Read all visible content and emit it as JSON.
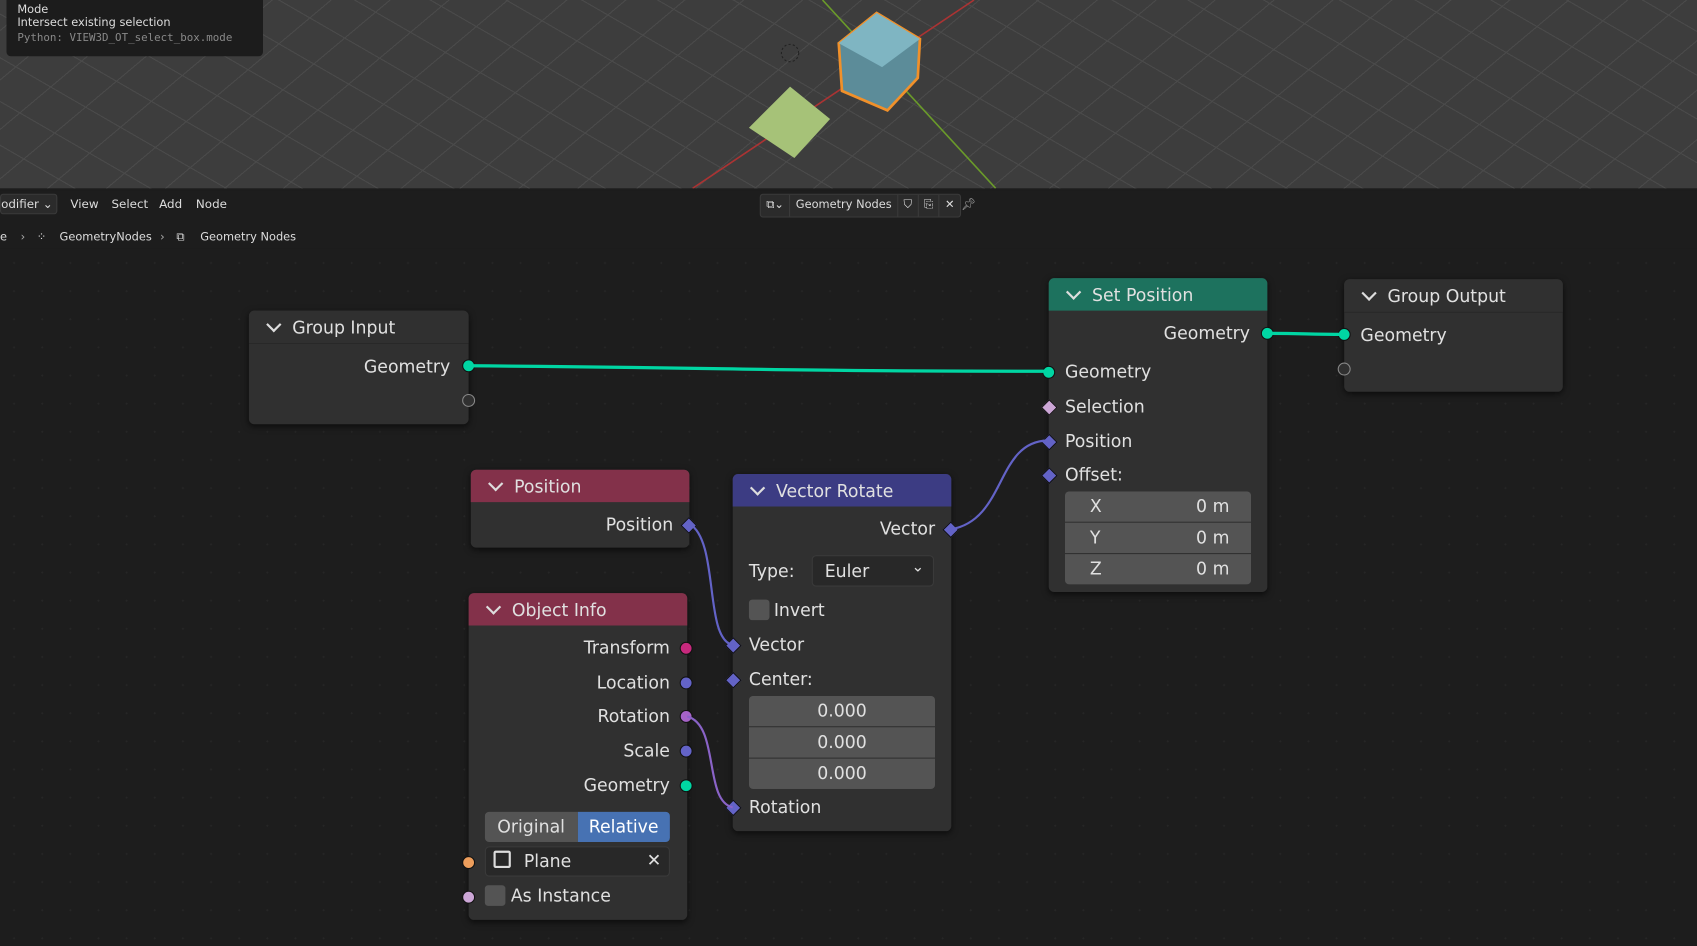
{
  "tooltip": {
    "title": "Mode",
    "desc": "Intersect existing selection",
    "python": "Python: VIEW3D_OT_select_box.mode"
  },
  "header": {
    "editor_type": "odifier",
    "menus": [
      "View",
      "Select",
      "Add",
      "Node"
    ],
    "node_group": "Geometry Nodes"
  },
  "breadcrumb": [
    "e",
    "GeometryNodes",
    "Geometry Nodes"
  ],
  "colors": {
    "geometry": "#00d6a3",
    "vector": "#6363c7",
    "rotation": "#a663c7",
    "matrix": "#c7297d",
    "object": "#ed9e5c",
    "bool": "#cca6d6",
    "geo_header": "#1d725e",
    "input_header": "#83314a",
    "vector_header": "#3c3c83"
  },
  "nodes": {
    "group_input": {
      "title": "Group Input",
      "outputs": [
        "Geometry"
      ]
    },
    "set_position": {
      "title": "Set Position",
      "output": "Geometry",
      "inputs": [
        "Geometry",
        "Selection",
        "Position",
        "Offset:"
      ],
      "offset": [
        {
          "axis": "X",
          "value": "0 m"
        },
        {
          "axis": "Y",
          "value": "0 m"
        },
        {
          "axis": "Z",
          "value": "0 m"
        }
      ]
    },
    "group_output": {
      "title": "Group Output",
      "inputs": [
        "Geometry"
      ]
    },
    "position": {
      "title": "Position",
      "output": "Position"
    },
    "vector_rotate": {
      "title": "Vector Rotate",
      "output": "Vector",
      "type_label": "Type:",
      "type_value": "Euler",
      "invert": "Invert",
      "inputs": [
        "Vector",
        "Center:",
        "Rotation"
      ],
      "center": [
        "0.000",
        "0.000",
        "0.000"
      ]
    },
    "object_info": {
      "title": "Object Info",
      "outputs": [
        "Transform",
        "Location",
        "Rotation",
        "Scale",
        "Geometry"
      ],
      "modes": [
        "Original",
        "Relative"
      ],
      "active_mode": "Relative",
      "object": "Plane",
      "as_instance": "As Instance"
    }
  }
}
